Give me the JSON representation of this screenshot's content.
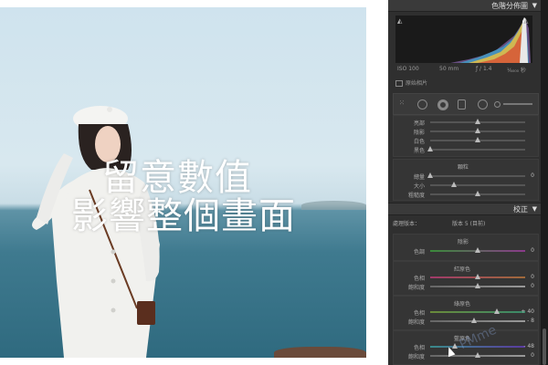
{
  "overlay": {
    "line1": "留意數值",
    "line2": "影響整個畫面"
  },
  "panel": {
    "histogram_title": "色階分佈圖",
    "camera": {
      "iso": "ISO 100",
      "focal": "50 mm",
      "aperture": "ƒ / 1.4",
      "shutter": "¹⁄₆₀₀₀ 秒"
    },
    "original_photo": "原始相片",
    "tone_group": [
      {
        "label": "亮部",
        "value": 0.5
      },
      {
        "label": "陰影",
        "value": 0.5
      },
      {
        "label": "白色",
        "value": 0.5
      },
      {
        "label": "黑色",
        "value": 0.0
      }
    ],
    "grain": {
      "title": "顆粒",
      "rows": [
        {
          "label": "總量",
          "value": 0.0,
          "val": "0"
        },
        {
          "label": "大小",
          "value": 0.25,
          "val": ""
        },
        {
          "label": "粗糙度",
          "value": 0.5,
          "val": ""
        }
      ]
    },
    "calibration_title": "校正",
    "process_label": "處理版本：",
    "process_value": "版本 5 (目前)",
    "shadow": {
      "title": "陰影",
      "rows": [
        {
          "label": "色調",
          "value": 0.5,
          "val": "0"
        }
      ]
    },
    "red": {
      "title": "紅原色",
      "rows": [
        {
          "label": "色相",
          "value": 0.5,
          "val": "0"
        },
        {
          "label": "飽和度",
          "value": 0.5,
          "val": "0"
        }
      ]
    },
    "green": {
      "title": "綠原色",
      "rows": [
        {
          "label": "色相",
          "value": 0.7,
          "val": "+ 40"
        },
        {
          "label": "飽和度",
          "value": 0.46,
          "val": "- 8"
        }
      ]
    },
    "blue": {
      "title": "藍原色",
      "rows": [
        {
          "label": "色相",
          "value": 0.26,
          "val": "- 48"
        },
        {
          "label": "飽和度",
          "value": 0.5,
          "val": "0"
        }
      ]
    }
  },
  "watermark": "PMme"
}
